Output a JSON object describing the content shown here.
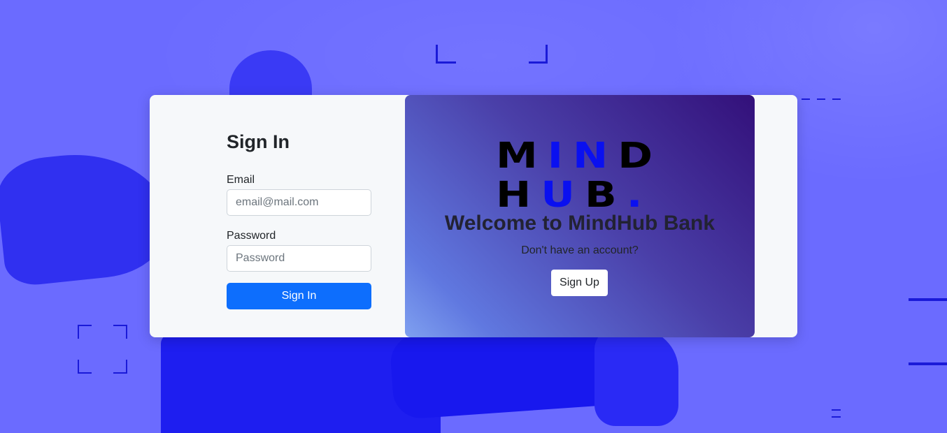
{
  "signin": {
    "title": "Sign In",
    "email_label": "Email",
    "email_placeholder": "email@mail.com",
    "password_label": "Password",
    "password_placeholder": "Password",
    "submit_label": "Sign In"
  },
  "brand": {
    "logo_line1": [
      "M",
      "I",
      "N",
      "D"
    ],
    "logo_line2": [
      "H",
      "U",
      "B",
      "."
    ],
    "logo_colors": {
      "dark": "#000000",
      "accent": "#0a10f0"
    }
  },
  "welcome": {
    "title": "Welcome to MindHub Bank",
    "subtitle": "Don't have an account?",
    "signup_label": "Sign Up"
  },
  "colors": {
    "background": "#6b6bff",
    "primary_button": "#0d6efd",
    "card": "#f6f8fa"
  }
}
